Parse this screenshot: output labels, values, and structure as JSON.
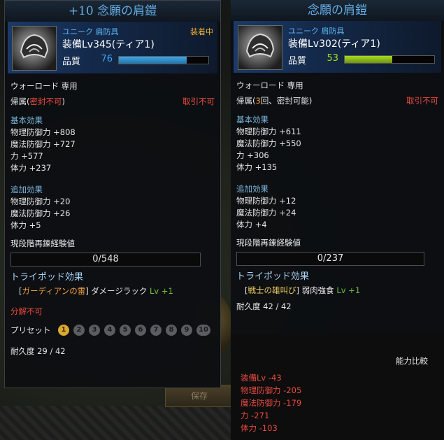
{
  "left": {
    "title": "+10 念願の肩鎧",
    "grade": "ユニーク 肩防具",
    "equipped": "装着中",
    "level": "装備Lv345(ティア1)",
    "quality_label": "品質",
    "quality": 76,
    "quality_color": "#3aa8ee",
    "class_line": "ウォーロード 専用",
    "bind_label": "帰属(",
    "bind_value": "密封不可",
    "bind_close": ")",
    "trade": "取引不可",
    "basic_title": "基本効果",
    "basic": [
      "物理防御力 +808",
      "魔法防御力 +727",
      "力 +577",
      "体力 +237"
    ],
    "extra_title": "追加効果",
    "extra": [
      "物理防御力 +20",
      "魔法防御力 +26",
      "体力 +5"
    ],
    "xp_title": "現段階再錬経験値",
    "xp": "0/548",
    "tripod_title": "トライポッド効果",
    "tripod_bracket_open": "[",
    "tripod_name": "ガーディアンの雷",
    "tripod_bracket_close": "]",
    "tripod_effect": "ダメージラック",
    "tripod_lv": "Lv +1",
    "disassemble": "分解不可",
    "preset_label": "プリセット",
    "presets": [
      "1",
      "2",
      "3",
      "4",
      "5",
      "6",
      "7",
      "8",
      "9",
      "10"
    ],
    "durability": "耐久度 29 / 42"
  },
  "right": {
    "title": "念願の肩鎧",
    "grade": "ユニーク 肩防具",
    "level": "装備Lv302(ティア1)",
    "quality_label": "品質",
    "quality": 53,
    "quality_color": "#a6dc1e",
    "class_line": "ウォーロード 専用",
    "bind_label": "帰属(",
    "bind_count": "3",
    "bind_rest": "回、密封可能)",
    "trade": "取引不可",
    "basic_title": "基本効果",
    "basic": [
      "物理防御力 +611",
      "魔法防御力 +550",
      "力 +306",
      "体力 +135"
    ],
    "extra_title": "追加効果",
    "extra": [
      "物理防御力 +12",
      "魔法防御力 +24",
      "体力 +4"
    ],
    "xp_title": "現段階再錬経験値",
    "xp": "0/237",
    "tripod_title": "トライポッド効果",
    "tripod_bracket_open": "[",
    "tripod_name": "戦士の雄叫び",
    "tripod_bracket_close": "]",
    "tripod_effect": "弱肉強食",
    "tripod_lv": "Lv +1",
    "durability": "耐久度 42 / 42"
  },
  "compare": {
    "title": "能力比較",
    "items": [
      "装備Lv -43",
      "物理防御力 -205",
      "魔法防御力 -179",
      "力 -271",
      "体力 -103"
    ]
  },
  "background": {
    "save_button": "保存"
  }
}
